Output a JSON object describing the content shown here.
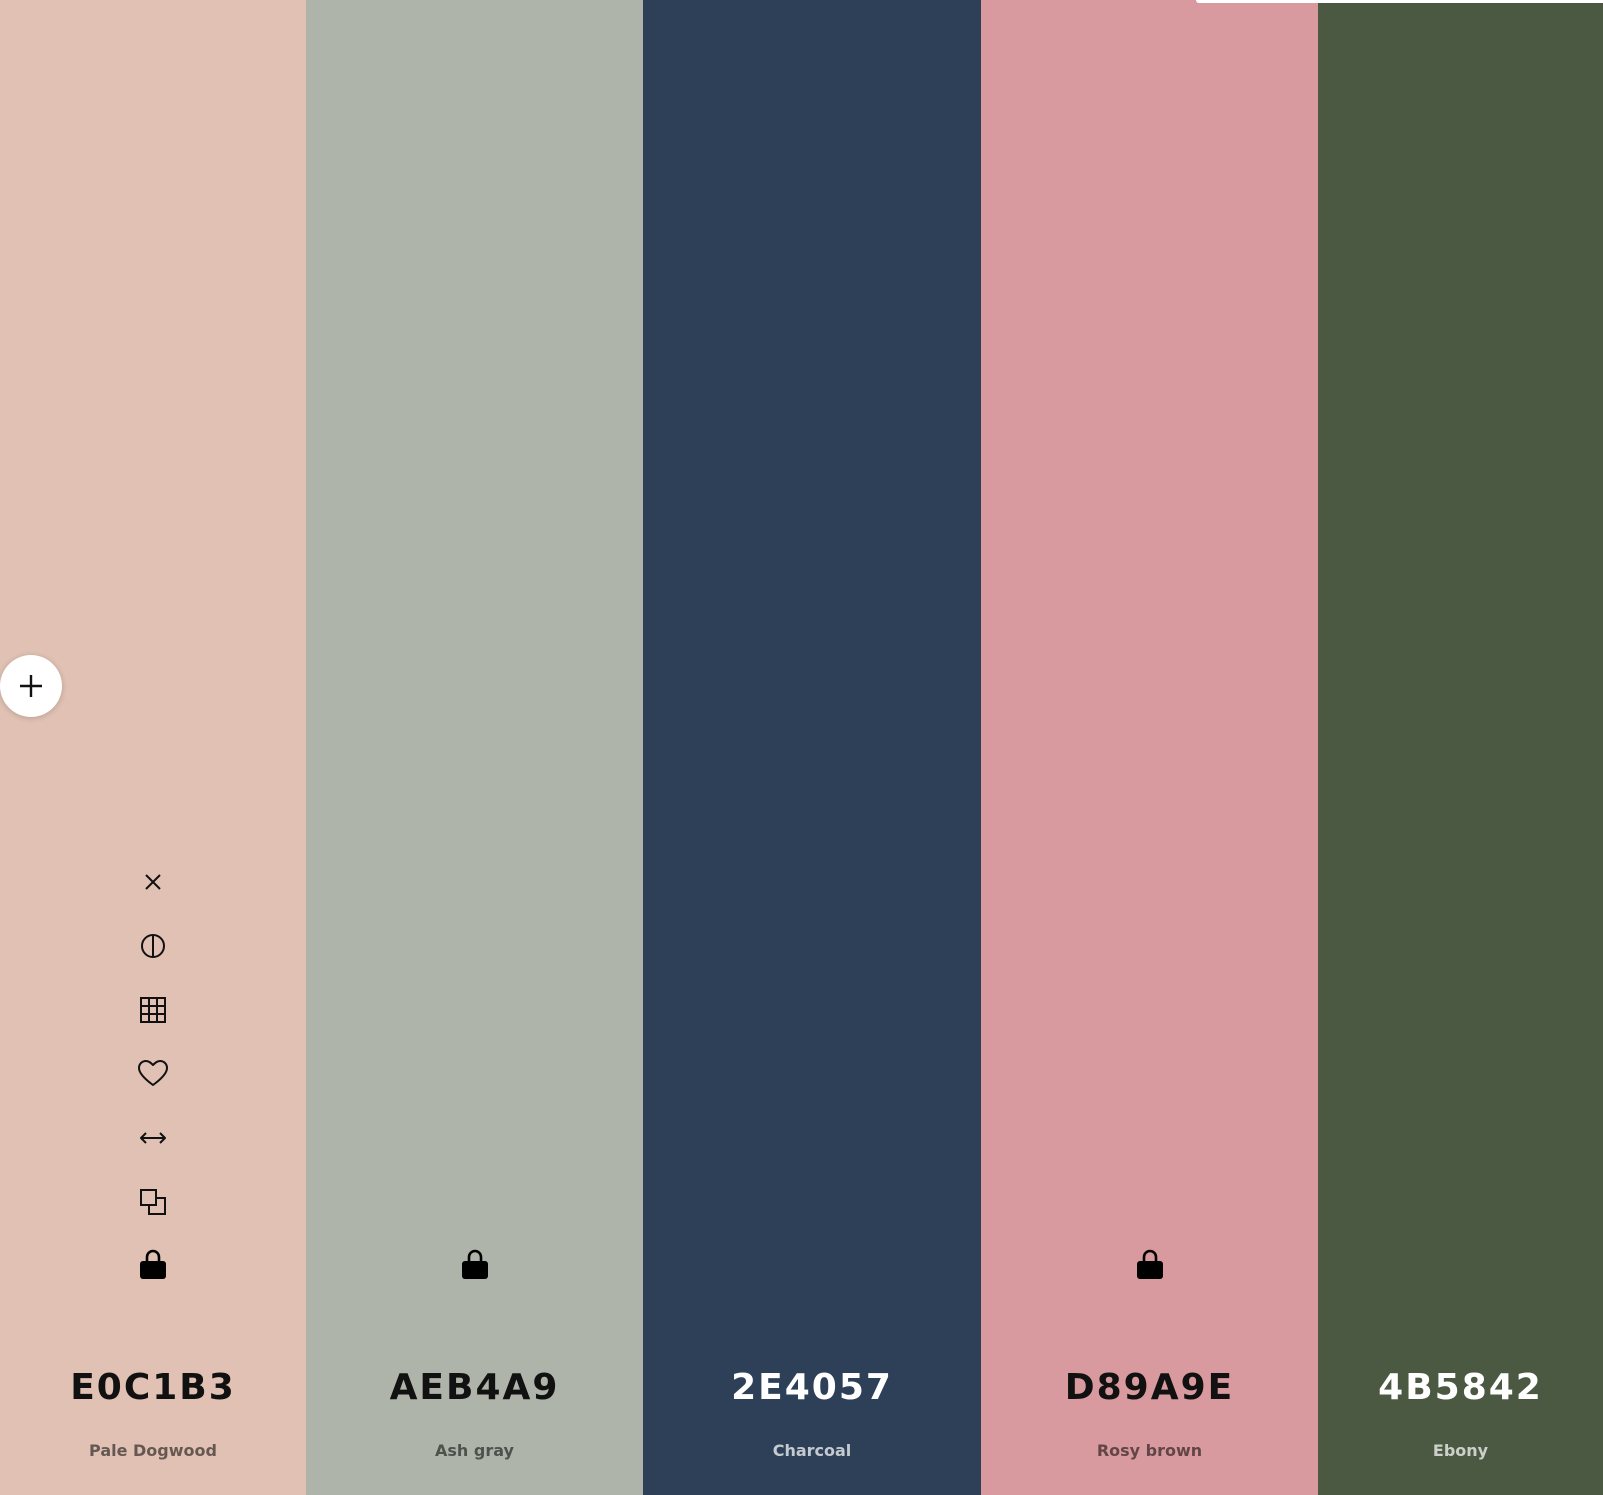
{
  "palette": {
    "swatches": [
      {
        "hex": "E0C1B3",
        "name": "Pale Dogwood",
        "color": "#E0C1B3",
        "locked": false
      },
      {
        "hex": "AEB4A9",
        "name": "Ash gray",
        "color": "#AEB4A9",
        "locked": false
      },
      {
        "hex": "2E4057",
        "name": "Charcoal",
        "color": "#2E4057",
        "locked": false
      },
      {
        "hex": "D89A9E",
        "name": "Rosy brown",
        "color": "#D89A9E",
        "locked": false
      },
      {
        "hex": "4B5842",
        "name": "Ebony",
        "color": "#4B5842",
        "locked": false
      }
    ]
  },
  "tool_icons": [
    "close-icon",
    "contrast-icon",
    "grid-icon",
    "heart-icon",
    "drag-arrows-icon",
    "copy-icon",
    "lock-icon"
  ],
  "add_button": {
    "icon": "plus-icon"
  }
}
